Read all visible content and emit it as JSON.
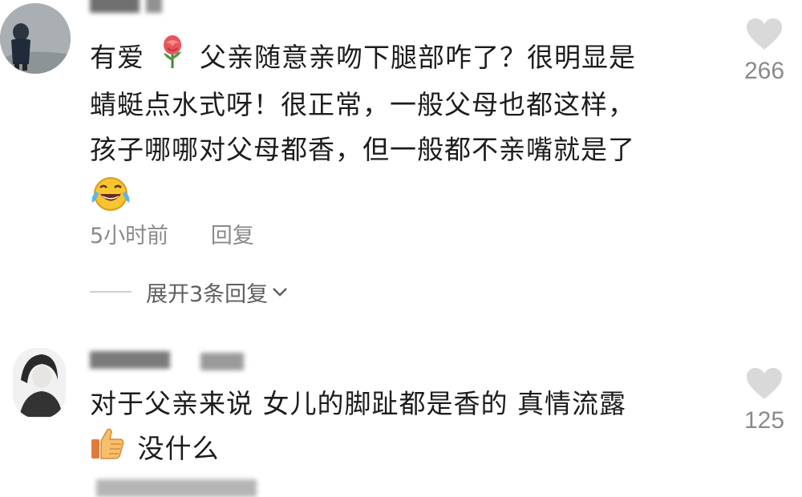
{
  "comments": [
    {
      "text_lines": [
        "有爱",
        "父亲随意亲吻下腿部咋了？很明显是",
        "蜻蜓点水式呀！很正常，一般父母也都这样，",
        "孩子哪哪对父母都香，但一般都不亲嘴就是了"
      ],
      "inline_icons": [
        "rose-emoji-icon",
        "laugh-cry-emoji-icon"
      ],
      "time": "5小时前",
      "reply_label": "回复",
      "like_count": "266",
      "expand_replies": "展开3条回复"
    },
    {
      "text_lines": [
        "对于父亲来说 女儿的脚趾都是香的 真情流露",
        "没什么"
      ],
      "inline_icons": [
        "thumbs-up-emoji-icon"
      ],
      "like_count": "125"
    }
  ],
  "icons": {
    "like": "heart-icon",
    "expand": "chevron-down-icon"
  },
  "colors": {
    "text": "#1c1c1c",
    "meta": "#8a8a8a",
    "heart": "#d9d9d9"
  }
}
